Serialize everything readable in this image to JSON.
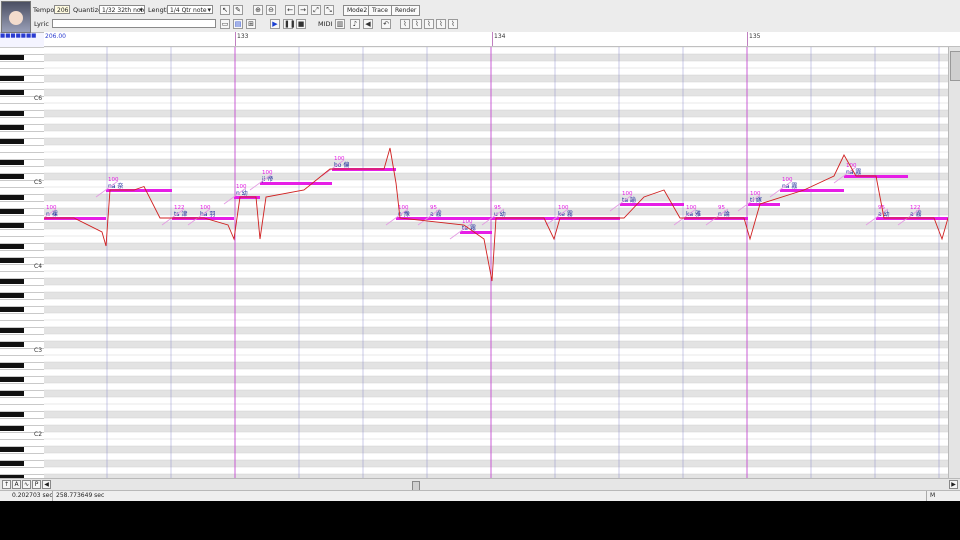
{
  "toolbar": {
    "tempo_label": "Tempo",
    "tempo_value": "206.0",
    "quantize_label": "Quantize",
    "quantize_value": "1/32 32th note",
    "length_label": "Length",
    "length_value": "1/4 Qtr note",
    "lyric_label": "Lyric",
    "lyric_value": "",
    "midi_label": "MIDI",
    "mode2_label": "Mode2",
    "trace_label": "Trace",
    "render_label": "Render"
  },
  "ruler": {
    "tempo_marker": "206.00",
    "measures": [
      "133",
      "134",
      "135"
    ]
  },
  "keyboard": {
    "octaves": [
      "C6",
      "C5",
      "C4",
      "C3",
      "C2"
    ]
  },
  "notes": [
    {
      "lyric": "n 裸",
      "vel": "100"
    },
    {
      "lyric": "na 奈",
      "vel": "100"
    },
    {
      "lyric": "ts 津",
      "vel": "122"
    },
    {
      "lyric": "ha 羽",
      "vel": "100"
    },
    {
      "lyric": "n 幼",
      "vel": "100"
    },
    {
      "lyric": "ji 帝",
      "vel": "100"
    },
    {
      "lyric": "bo 偏",
      "vel": "100"
    },
    {
      "lyric": "n 豫",
      "vel": "100"
    },
    {
      "lyric": "a 霧",
      "vel": "95"
    },
    {
      "lyric": "te 霧",
      "vel": "100"
    },
    {
      "lyric": "u 幼",
      "vel": "95"
    },
    {
      "lyric": "ke 霧",
      "vel": "100"
    },
    {
      "lyric": "ta 諭",
      "vel": "100"
    },
    {
      "lyric": "ka 雅",
      "vel": "100"
    },
    {
      "lyric": "n 論",
      "vel": "95"
    },
    {
      "lyric": "ti 嫁",
      "vel": "100"
    },
    {
      "lyric": "na 霧",
      "vel": "100"
    },
    {
      "lyric": "na 霧",
      "vel": "100"
    },
    {
      "lyric": "a 幼",
      "vel": "95"
    },
    {
      "lyric": "a 霧",
      "vel": "122"
    }
  ],
  "statusbar": {
    "time_start": "0.202703 sec",
    "time_end": "258.773649 sec",
    "mode": "M"
  },
  "colors": {
    "note": "#e61ee6",
    "pitch": "#d02020",
    "measure_line": "#c44bd0",
    "beat_line": "#8080c8",
    "row_dark": "#e3e3e3"
  }
}
